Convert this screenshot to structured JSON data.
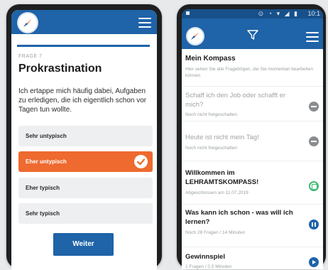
{
  "left_screen": {
    "progress_percent": 100,
    "frage_label": "FRAGE 7",
    "title": "Prokrastination",
    "question": "Ich ertappe mich häufig dabei, Aufgaben zu erledigen, die ich eigentlich schon vor Tagen tun wollte.",
    "options": [
      {
        "label": "Sehr untypisch",
        "selected": false
      },
      {
        "label": "Eher untypisch",
        "selected": true
      },
      {
        "label": "Eher typisch",
        "selected": false
      },
      {
        "label": "Sehr typisch",
        "selected": false
      }
    ],
    "next_button": "Weiter"
  },
  "right_screen": {
    "status_time": "10:1",
    "list_title": "Mein Kompass",
    "list_desc": "Hier sehen Sie alle Fragebögen, die Sie momentan bearbeiten können",
    "items": [
      {
        "title": "Schaff ich den Job oder schafft er mich?",
        "sub": "Noch nicht freigeschalten",
        "state": "locked",
        "icon": "lock-icon"
      },
      {
        "title": "Heute ist nicht mein Tag!",
        "sub": "Noch nicht freigeschalten",
        "state": "locked",
        "icon": "lock-icon"
      },
      {
        "title": "Willkommen im LEHRAMTSKOMPASS!",
        "sub": "Abgeschlossen am 11.07.2019",
        "state": "done",
        "icon": "done-icon"
      },
      {
        "title": "Was kann ich schon - was will ich lernen?",
        "sub": "Noch 28 Fragen / 14 Minuten",
        "state": "in-progress",
        "icon": "pause-icon"
      },
      {
        "title": "Gewinnspiel",
        "sub": "1 Fragen / 0,5 Minuten",
        "state": "open",
        "icon": "play-icon"
      }
    ]
  },
  "colors": {
    "primary": "#1f63a8",
    "accent": "#ee6a2f",
    "success": "#3cba72",
    "background": "#e7e9ea"
  }
}
